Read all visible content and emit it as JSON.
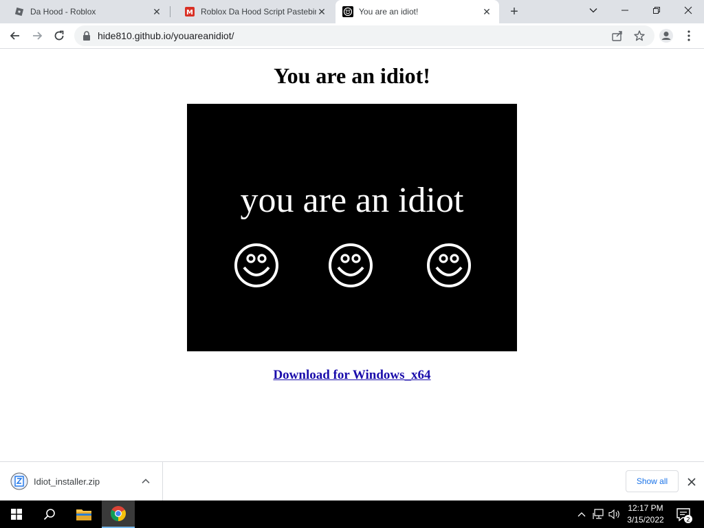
{
  "browser": {
    "tabs": [
      {
        "title": "Da Hood - Roblox",
        "active": false
      },
      {
        "title": "Roblox Da Hood Script Pastebin [",
        "active": false
      },
      {
        "title": "You are an idiot!",
        "active": true
      }
    ],
    "url": "hide810.github.io/youareanidiot/"
  },
  "page": {
    "heading": "You are an idiot!",
    "video_caption": "you are an idiot",
    "download_link": "Download for Windows_x64"
  },
  "download_bar": {
    "file_name": "Idiot_installer.zip",
    "show_all_label": "Show all"
  },
  "taskbar": {
    "time": "12:17 PM",
    "date": "3/15/2022",
    "notification_count": "2"
  },
  "colors": {
    "link": "#1a0dab",
    "accent": "#1a73e8",
    "video_bg": "#000000"
  }
}
